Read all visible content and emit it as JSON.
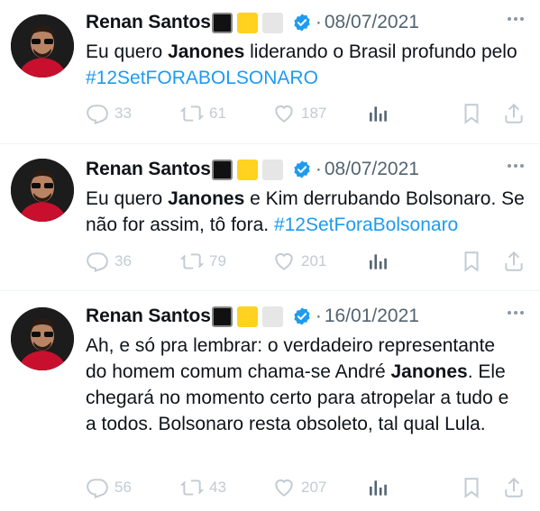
{
  "colors": {
    "name": "#0f1419",
    "secondary": "#536471",
    "hashtag": "#1d9bf0",
    "verified": "#1d9bf0",
    "action_icons": "#c2cbd3",
    "divider": "#eff3f4",
    "square_black": "#111111",
    "square_yellow": "#ffd21f",
    "square_white": "#e6e6e6"
  },
  "icons": [
    "verified-badge-icon",
    "more-icon",
    "reply-icon",
    "retweet-icon",
    "like-icon",
    "views-icon",
    "bookmark-icon",
    "share-icon"
  ],
  "tweets": [
    {
      "author": "Renan Santos",
      "separator": "·",
      "date": "08/07/2021",
      "text": {
        "p1": "Eu quero ",
        "bold1": "Janones",
        "p2": " liderando o Brasil profundo pelo ",
        "hashtag": "#12SetFORABOLSONARO"
      },
      "replies": "33",
      "retweets": "61",
      "likes": "187"
    },
    {
      "author": "Renan Santos",
      "separator": "·",
      "date": "08/07/2021",
      "text": {
        "p1": "Eu quero ",
        "bold1": "Janones",
        "p2": " e Kim derrubando Bolsonaro. Se não for assim, tô fora. ",
        "hashtag": "#12SetForaBolsonaro"
      },
      "replies": "36",
      "retweets": "79",
      "likes": "201"
    },
    {
      "author": "Renan Santos",
      "separator": "·",
      "date": "16/01/2021",
      "text": {
        "p1": "Ah, e só pra lembrar: o verdadeiro representante do homem comum chama-se André ",
        "bold1": "Janones",
        "p2": ". Ele chegará no momento certo para atropelar a tudo e a todos. Bolsonaro resta obsoleto, tal qual Lula."
      },
      "replies": "56",
      "retweets": "43",
      "likes": "207"
    }
  ]
}
